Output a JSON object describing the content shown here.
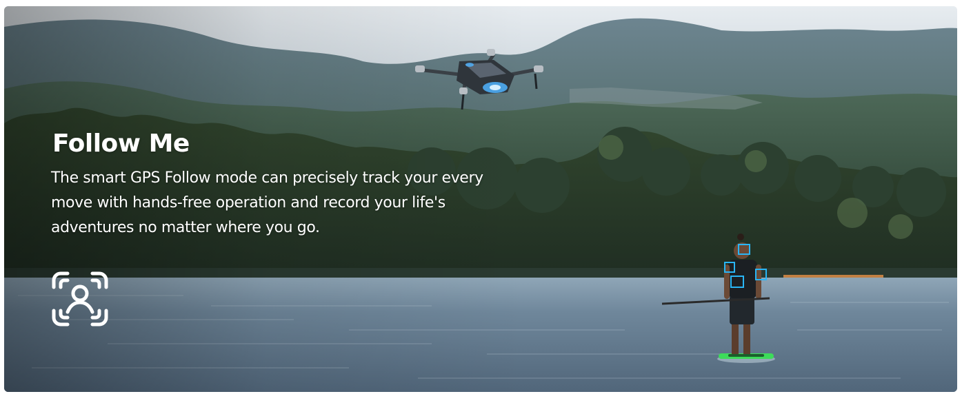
{
  "feature": {
    "title": "Follow Me",
    "description": "The smart GPS Follow mode can precisely track your every move with hands-free operation and record your life's adventures no matter where you go.",
    "icon": "face-tracking-icon"
  },
  "scene": {
    "elements": [
      "drone",
      "paddleboarder",
      "lake",
      "forested-hills"
    ],
    "tracking_box_color": "#29b6f6",
    "board_color": "#3ddc5a"
  }
}
